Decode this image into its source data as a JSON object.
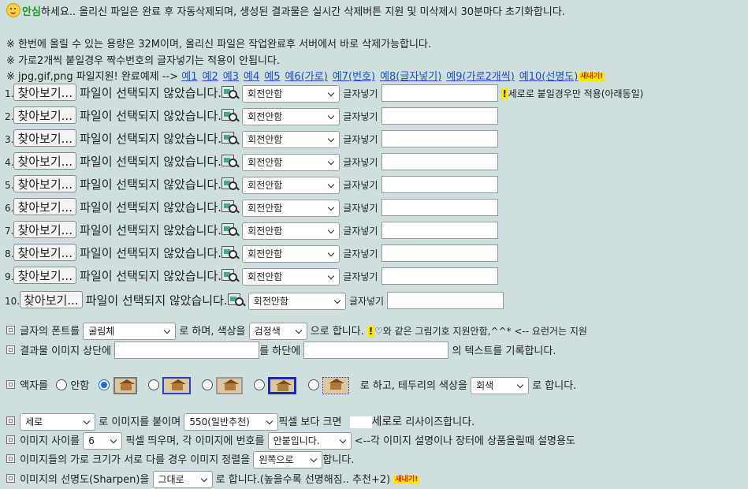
{
  "intro": {
    "brand": "안심",
    "text": "하세요.. 올리신 파일은 완료 후 자동삭제되며, 생성된 결과물은 실시간 삭제버튼 지원 및 미삭제시 30분마다 초기화합니다."
  },
  "notes": [
    "※ 한번에 올릴 수 있는 용량은 32M이며, 올리신 파일은 작업완료후 서버에서 바로 삭제가능합니다.",
    "※ 가로2개씩 붙일경우 짝수번호의 글자넣기는 적용이 안됩니다."
  ],
  "examples": {
    "prefix": "※ jpg,gif,png 파일지원! 완료예제 -->",
    "links": [
      "예1",
      "예2",
      "예3",
      "예4",
      "예5",
      "예6(가로)",
      "예7(번호)",
      "예8(글자넣기)",
      "예9(가로2개씩)",
      "예10(선명도)"
    ],
    "new_badge": "새내기!"
  },
  "file_rows": {
    "browse_label": "찾아보기...",
    "no_file_text": "파일이 선택되지 않았습니다.",
    "rotate_value": "회전안함",
    "text_label": "글자넣기",
    "vertical_note": "세로로 붙일경우만 적용(아래동일)",
    "numbers": [
      "1.",
      "2.",
      "3.",
      "4.",
      "5.",
      "6.",
      "7.",
      "8.",
      "9.",
      "10."
    ]
  },
  "font_row": {
    "prefix": "글자의 폰트를",
    "font_value": "굴림체",
    "mid": "로 하며, 색상을",
    "color_value": "검정색",
    "suffix": "으로 합니다.",
    "hint": "♡와 같은 그림기호 지원안함,^^* <-- 요런거는 지원"
  },
  "caption_row": {
    "prefix": "결과물 이미지 상단에",
    "mid": "를 하단에",
    "suffix": "의 텍스트를 기록합니다."
  },
  "frame_row": {
    "prefix": "액자를",
    "none_label": "안함",
    "suffix": "로 하고, 테두리의 색상을",
    "border_color_value": "회색",
    "suffix2": "로 합니다."
  },
  "layout_row": {
    "direction_value": "세로",
    "mid": "로 이미지를 붙이며",
    "width_value": "550(일반추천)",
    "mid2": "픽셀 보다 크면",
    "resize_word": "세로로",
    "suffix": "리사이즈합니다."
  },
  "gap_row": {
    "prefix": "이미지 사이를",
    "gap_value": "6",
    "mid": "픽셀 띄우며, 각 이미지에 번호를",
    "number_value": "안붙입니다.",
    "suffix": "<--각 이미지 설명이나 장터에 상품올릴때 설명용도"
  },
  "align_row": {
    "prefix": "이미지들의 가로 크기가 서로 다를 경우 이미지 정렬을",
    "align_value": "왼쪽으로",
    "suffix": "합니다."
  },
  "sharpen_row": {
    "prefix": "이미지의 선명도(Sharpen)을",
    "sharpen_value": "그대로",
    "suffix": "로 합니다.(높을수록 선명해짐.. 추천+2)",
    "new_badge": "새내기!"
  },
  "colors": {
    "background": "#cfdfe0",
    "link": "#1a4fd6",
    "brand": "#1a9a1a",
    "badge": "#ffe600"
  }
}
